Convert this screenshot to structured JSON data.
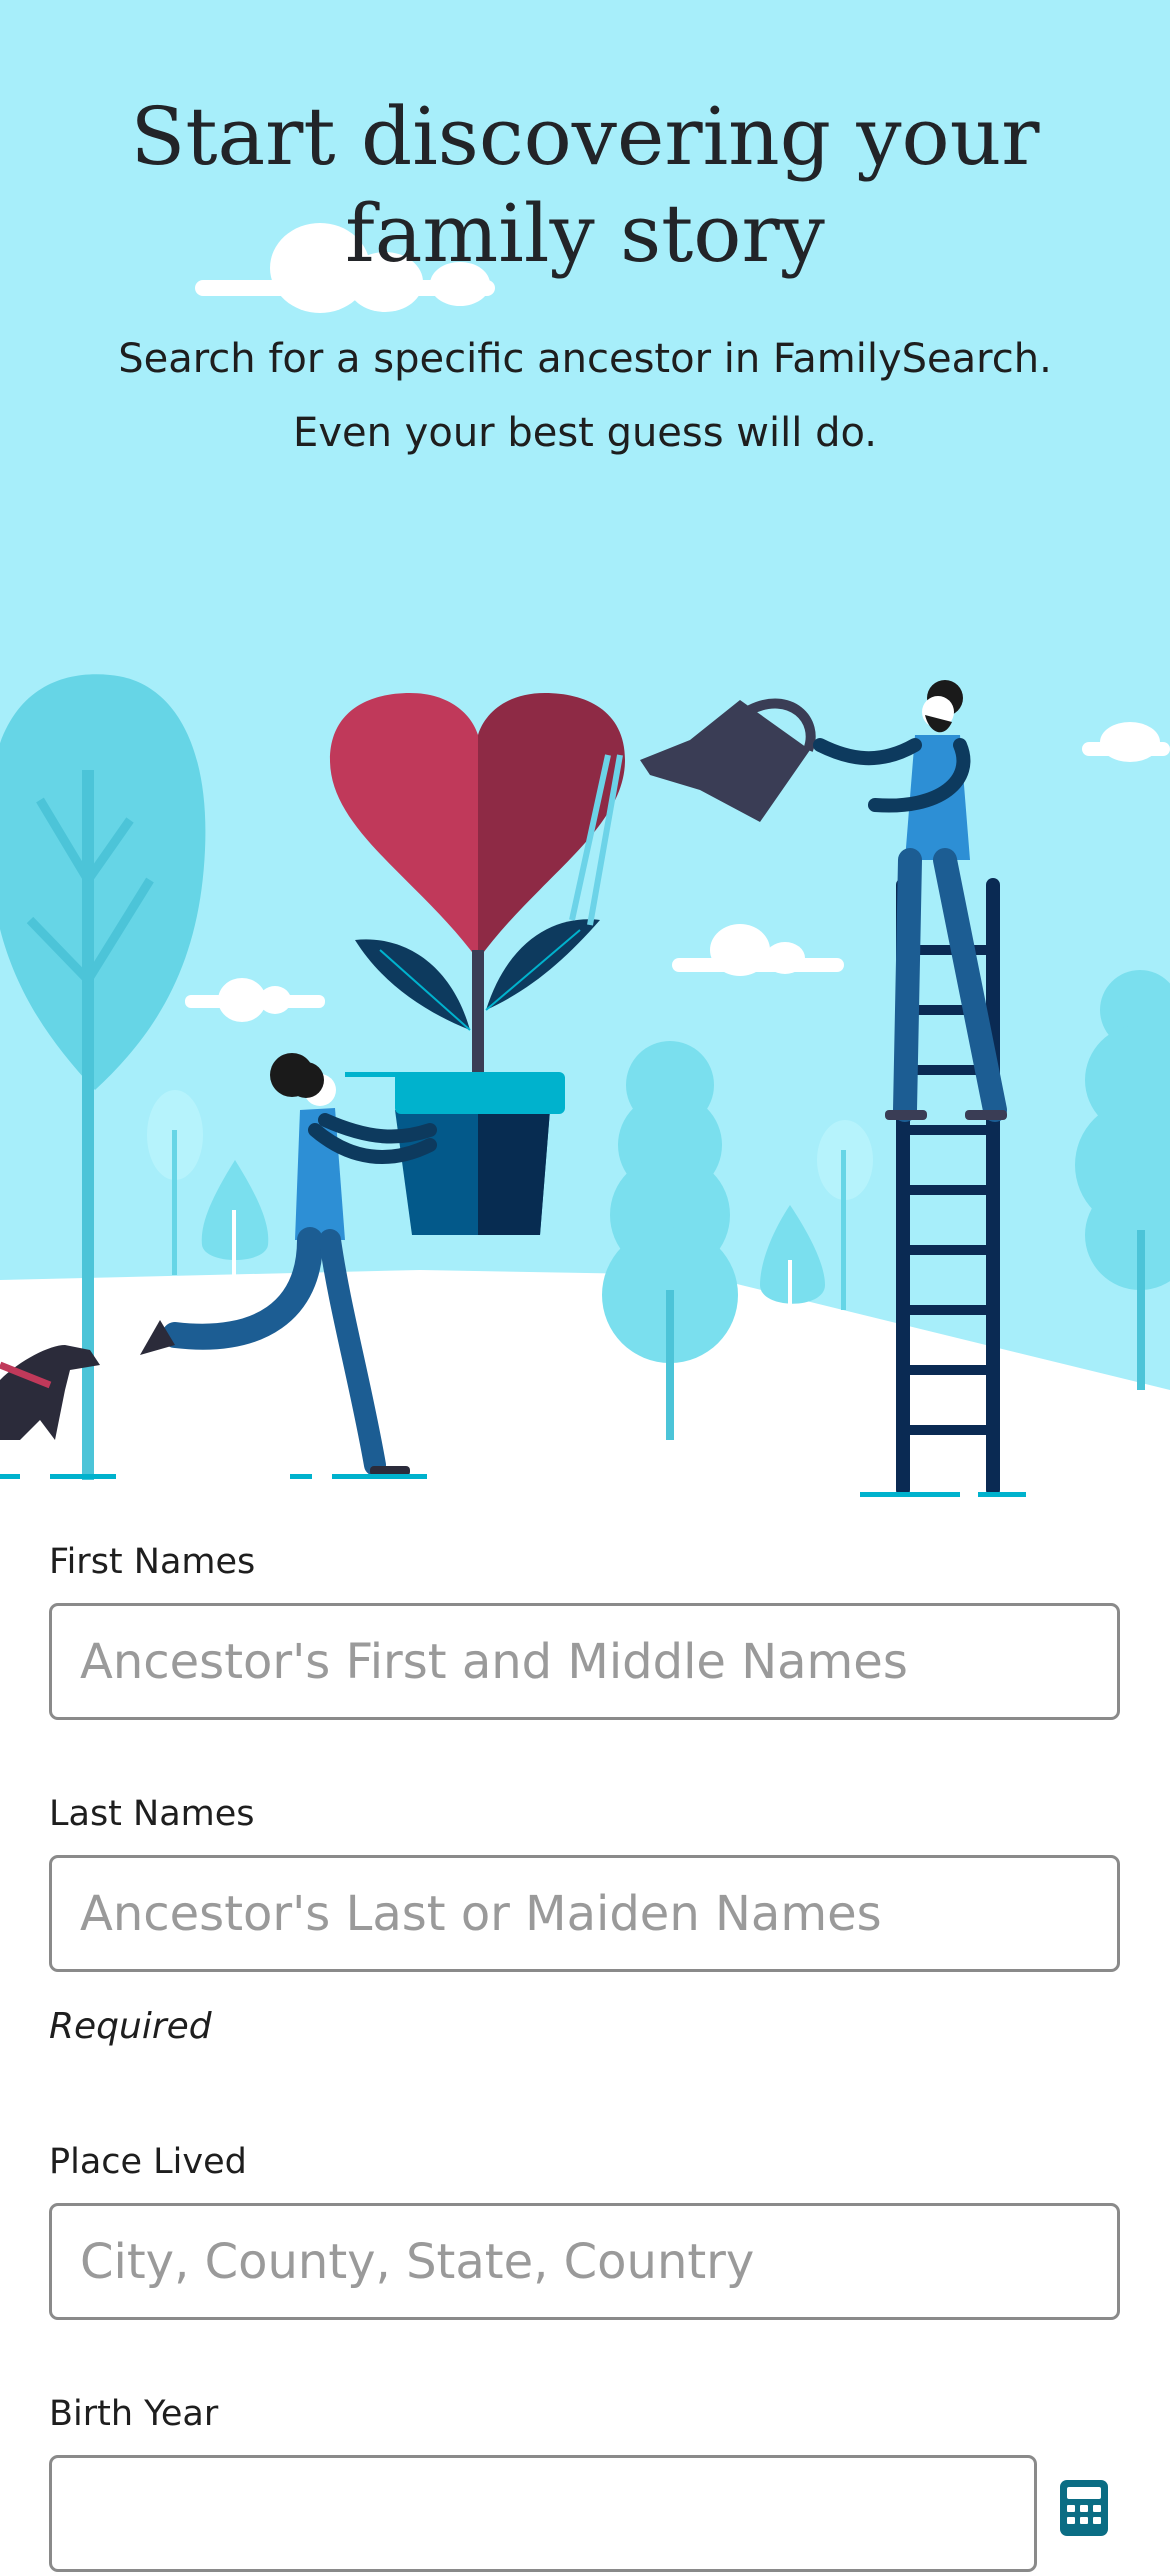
{
  "hero": {
    "title_line1": "Start discovering your",
    "title_line2": "family story",
    "subtitle_line1": "Search for a specific ancestor in FamilySearch.",
    "subtitle_line2": "Even your best guess will do."
  },
  "form": {
    "first_names": {
      "label": "First Names",
      "placeholder": "Ancestor's First and Middle Names",
      "value": ""
    },
    "last_names": {
      "label": "Last Names",
      "placeholder": "Ancestor's Last or Maiden Names",
      "value": "",
      "note": "Required"
    },
    "place_lived": {
      "label": "Place Lived",
      "placeholder": "City, County, State, Country",
      "value": ""
    },
    "birth_year": {
      "label": "Birth Year",
      "placeholder": "",
      "value": "",
      "icon": "calculator-icon"
    }
  },
  "colors": {
    "sky": "#a7eefa",
    "heart_left": "#c0395a",
    "heart_right": "#8e2a45",
    "navy": "#0d2a4f",
    "blue": "#2d8fd5",
    "teal": "#00b2cd"
  }
}
